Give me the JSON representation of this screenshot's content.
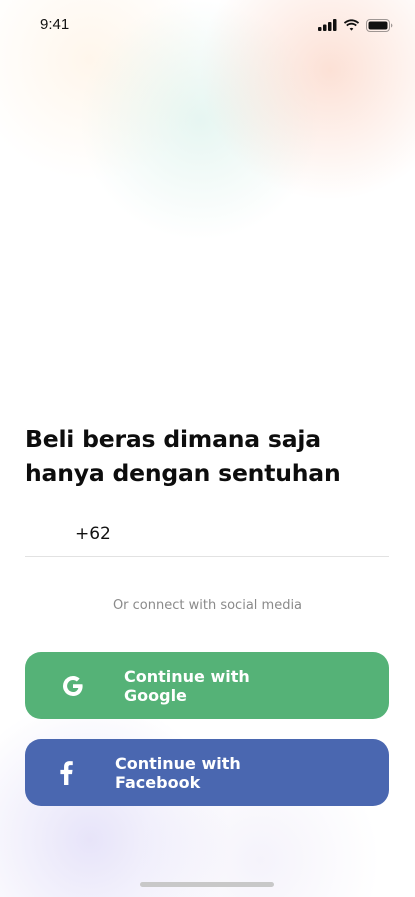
{
  "status_bar": {
    "time": "9:41",
    "icons": [
      "cellular-signal-icon",
      "wifi-icon",
      "battery-icon"
    ]
  },
  "headline": {
    "line1": "Beli beras dimana saja",
    "line2": "hanya dengan sentuhan"
  },
  "phone": {
    "prefix": "+62",
    "value": "",
    "placeholder": ""
  },
  "divider_text": "Or connect with social media",
  "buttons": {
    "google": {
      "line1": "Continue with",
      "line2": "Google",
      "icon": "google-icon",
      "color": "#55b277"
    },
    "facebook": {
      "line1": "Continue with",
      "line2": "Facebook",
      "icon": "facebook-icon",
      "color": "#4a67b0"
    }
  }
}
